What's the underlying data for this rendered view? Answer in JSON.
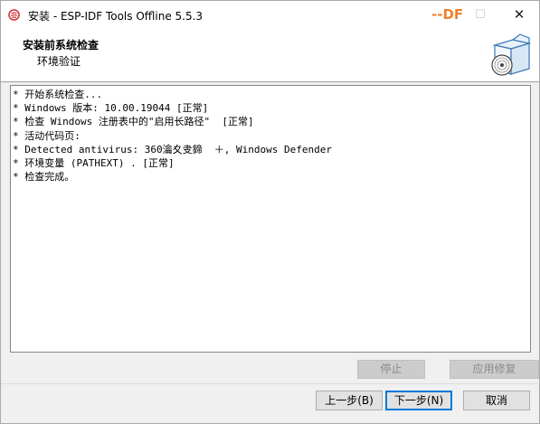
{
  "window": {
    "title": "安装 - ESP-IDF Tools Offline 5.5.3",
    "watermark_dash": "--",
    "watermark_text": "DF",
    "maximize_glyph": "☐",
    "close_glyph": "✕"
  },
  "header": {
    "title": "安装前系统检查",
    "subtitle": "环境验证",
    "icon": "installer-box-disc-icon"
  },
  "log": {
    "lines": [
      "* 开始系统检查...",
      "* Windows 版本: 10.00.19044 [正常]",
      "* 检查 Windows 注册表中的\"启用长路径\"  [正常]",
      "* 活动代码页:",
      "* Detected antivirus: 360瀹夊叏鍗  ＋, Windows Defender",
      "* 环境变量 (PATHEXT) . [正常]",
      "* 检查完成。"
    ]
  },
  "actions": {
    "stop_label": "停止",
    "repair_label": "应用修复"
  },
  "nav": {
    "back_label": "上一步(B)",
    "next_label": "下一步(N)",
    "cancel_label": "取消"
  },
  "colors": {
    "accent": "#0078d7",
    "watermark": "#f08030"
  }
}
